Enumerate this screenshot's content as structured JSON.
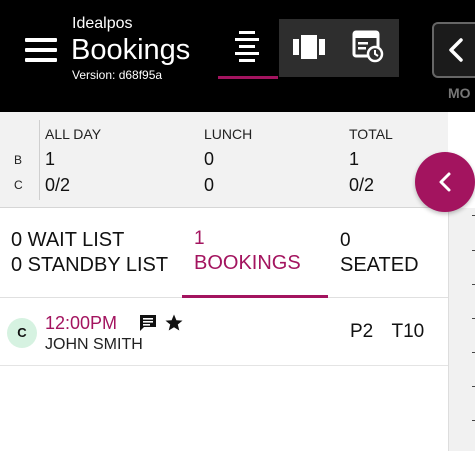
{
  "header": {
    "brand": "Idealpos",
    "title": "Bookings",
    "version": "Version: d68f95a",
    "view_buttons": [
      {
        "icon": "list-view-icon",
        "active": true
      },
      {
        "icon": "table-view-icon",
        "active": false
      },
      {
        "icon": "schedule-view-icon",
        "active": false
      }
    ],
    "more_label": "MO"
  },
  "summary": {
    "rows": [
      "B",
      "C"
    ],
    "columns": [
      {
        "header": "ALL DAY",
        "b": "1",
        "c": "0/2"
      },
      {
        "header": "LUNCH",
        "b": "0",
        "c": "0"
      },
      {
        "header": "TOTAL",
        "b": "1",
        "c": "0/2"
      }
    ]
  },
  "tabs": {
    "waitlist": "0 WAIT LIST",
    "standby": "0 STANDBY LIST",
    "bookings_count": "1",
    "bookings_label": "BOOKINGS",
    "seated_count": "0",
    "seated_label": "SEATED",
    "active": "bookings"
  },
  "bookings": [
    {
      "avatar": "C",
      "time": "12:00PM",
      "name": "JOHN SMITH",
      "party": "P2",
      "table": "T10",
      "icons": [
        "comment-icon",
        "star-icon"
      ]
    }
  ],
  "colors": {
    "accent": "#a3145f",
    "topbar": "#000000",
    "avatar_bg": "#d6f2e1"
  }
}
